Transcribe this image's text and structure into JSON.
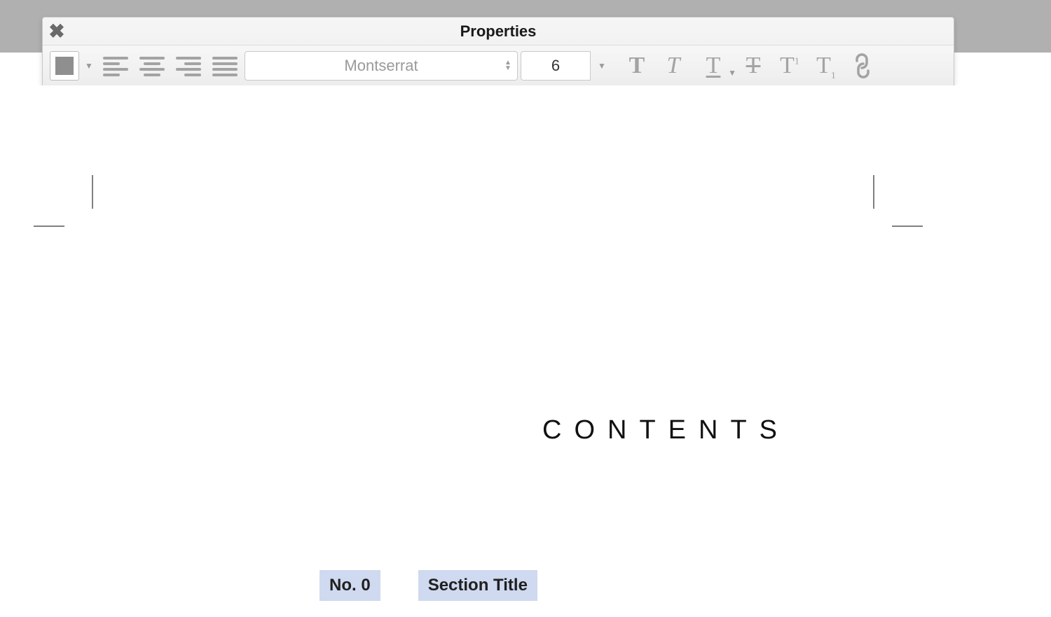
{
  "window": {
    "title": "Properties"
  },
  "toolbar": {
    "swatch_color": "#8f8f8f",
    "font_family": "Montserrat",
    "font_size": "6"
  },
  "document": {
    "heading": "CONTENTS",
    "selected_field_1": "No. 0",
    "selected_field_2": "Section Title"
  }
}
